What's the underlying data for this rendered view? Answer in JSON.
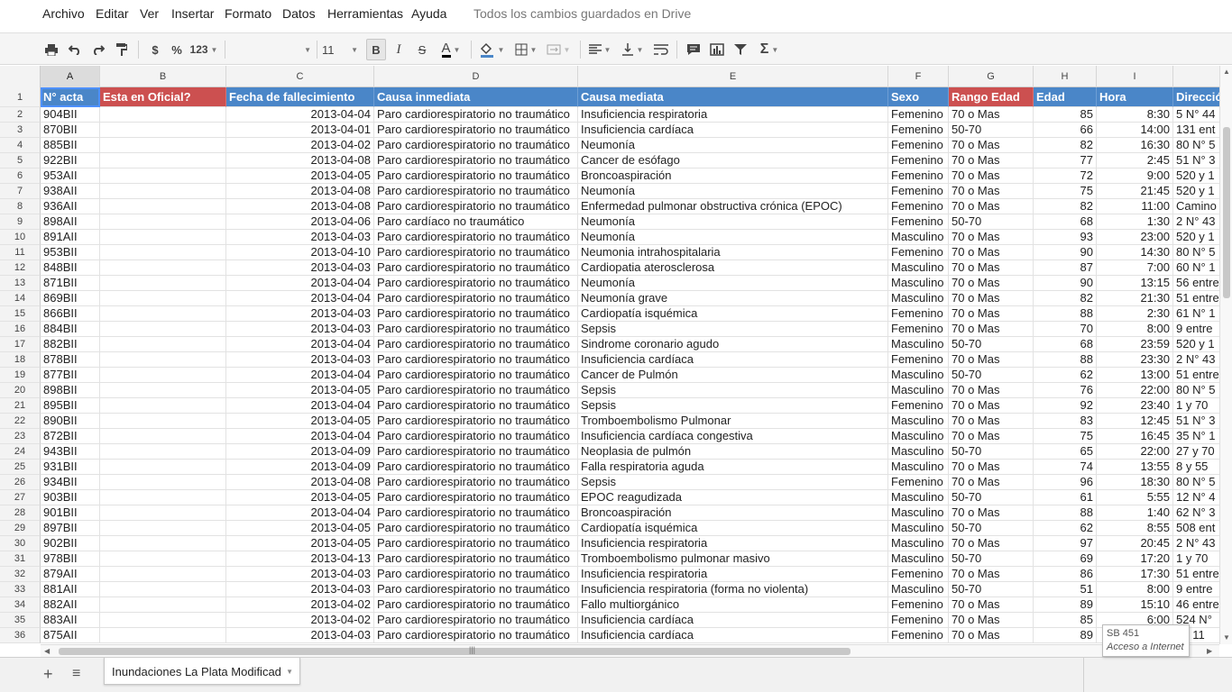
{
  "menu": {
    "items": [
      "Archivo",
      "Editar",
      "Ver",
      "Insertar",
      "Formato",
      "Datos",
      "Herramientas",
      "Ayuda"
    ],
    "save_status": "Todos los cambios guardados en Drive"
  },
  "toolbar": {
    "currency": "$",
    "percent": "%",
    "number_format": "123",
    "font_size": "11",
    "bold": "B",
    "italic": "I",
    "strike": "S",
    "text_color": "A",
    "sum": "Σ"
  },
  "columns": [
    "A",
    "B",
    "C",
    "D",
    "E",
    "F",
    "G",
    "H",
    "I",
    ""
  ],
  "headers": [
    "N° acta",
    "Esta en Oficial?",
    "Fecha de fallecimiento",
    "Causa inmediata",
    "Causa mediata",
    "Sexo",
    "Rango Edad",
    "Edad",
    "Hora",
    "Direcció"
  ],
  "row_numbers": [
    "1",
    "2",
    "3",
    "4",
    "5",
    "6",
    "7",
    "8",
    "9",
    "10",
    "11",
    "12",
    "13",
    "14",
    "15",
    "16",
    "17",
    "18",
    "19",
    "20",
    "21",
    "22",
    "23",
    "24",
    "25",
    "26",
    "27",
    "28",
    "29",
    "30",
    "31",
    "32",
    "33",
    "34",
    "35",
    "36"
  ],
  "rows": [
    [
      "904BII",
      "",
      "2013-04-04",
      "Paro cardiorespiratorio no traumático",
      "Insuficiencia respiratoria",
      "Femenino",
      "70 o Mas",
      "85",
      "8:30",
      "5 N° 44"
    ],
    [
      "870BII",
      "",
      "2013-04-01",
      "Paro cardiorespiratorio no traumático",
      "Insuficiencia cardíaca",
      "Femenino",
      "50-70",
      "66",
      "14:00",
      "131 ent"
    ],
    [
      "885BII",
      "",
      "2013-04-02",
      "Paro cardiorespiratorio no traumático",
      "Neumonía",
      "Femenino",
      "70 o Mas",
      "82",
      "16:30",
      "80 N° 5"
    ],
    [
      "922BII",
      "",
      "2013-04-08",
      "Paro cardiorespiratorio no traumático",
      "Cancer de esófago",
      "Femenino",
      "70 o Mas",
      "77",
      "2:45",
      "51 N° 3"
    ],
    [
      "953AII",
      "",
      "2013-04-05",
      "Paro cardiorespiratorio no traumático",
      "Broncoaspiración",
      "Femenino",
      "70 o Mas",
      "72",
      "9:00",
      "520 y 1"
    ],
    [
      "938AII",
      "",
      "2013-04-08",
      "Paro cardiorespiratorio no traumático",
      "Neumonía",
      "Femenino",
      "70 o Mas",
      "75",
      "21:45",
      "520 y 1"
    ],
    [
      "936AII",
      "",
      "2013-04-08",
      "Paro cardiorespiratorio no traumático",
      "Enfermedad pulmonar obstructiva crónica (EPOC)",
      "Femenino",
      "70 o Mas",
      "82",
      "11:00",
      "Camino"
    ],
    [
      "898AII",
      "",
      "2013-04-06",
      "Paro cardíaco no traumático",
      "Neumonía",
      "Femenino",
      "50-70",
      "68",
      "1:30",
      "2 N° 43"
    ],
    [
      "891AII",
      "",
      "2013-04-03",
      "Paro cardiorespiratorio no traumático",
      "Neumonía",
      "Masculino",
      "70 o Mas",
      "93",
      "23:00",
      "520 y 1"
    ],
    [
      "953BII",
      "",
      "2013-04-10",
      "Paro cardiorespiratorio no traumático",
      "Neumonia intrahospitalaria",
      "Femenino",
      "70 o Mas",
      "90",
      "14:30",
      "80 N° 5"
    ],
    [
      "848BII",
      "",
      "2013-04-03",
      "Paro cardiorespiratorio no traumático",
      "Cardiopatia aterosclerosa",
      "Masculino",
      "70 o Mas",
      "87",
      "7:00",
      "60 N° 1"
    ],
    [
      "871BII",
      "",
      "2013-04-04",
      "Paro cardiorespiratorio no traumático",
      "Neumonía",
      "Masculino",
      "70 o Mas",
      "90",
      "13:15",
      "56 entre"
    ],
    [
      "869BII",
      "",
      "2013-04-04",
      "Paro cardiorespiratorio no traumático",
      "Neumonía grave",
      "Masculino",
      "70 o Mas",
      "82",
      "21:30",
      "51 entre"
    ],
    [
      "866BII",
      "",
      "2013-04-03",
      "Paro cardiorespiratorio no traumático",
      "Cardiopatía isquémica",
      "Femenino",
      "70 o Mas",
      "88",
      "2:30",
      "61 N° 1"
    ],
    [
      "884BII",
      "",
      "2013-04-03",
      "Paro cardiorespiratorio no traumático",
      "Sepsis",
      "Femenino",
      "70 o Mas",
      "70",
      "8:00",
      "9 entre"
    ],
    [
      "882BII",
      "",
      "2013-04-04",
      "Paro cardiorespiratorio no traumático",
      "Sindrome coronario agudo",
      "Masculino",
      "50-70",
      "68",
      "23:59",
      "520 y 1"
    ],
    [
      "878BII",
      "",
      "2013-04-03",
      "Paro cardiorespiratorio no traumático",
      "Insuficiencia cardíaca",
      "Femenino",
      "70 o Mas",
      "88",
      "23:30",
      "2 N° 43"
    ],
    [
      "877BII",
      "",
      "2013-04-04",
      "Paro cardiorespiratorio no traumático",
      "Cancer de Pulmón",
      "Masculino",
      "50-70",
      "62",
      "13:00",
      "51 entre"
    ],
    [
      "898BII",
      "",
      "2013-04-05",
      "Paro cardiorespiratorio no traumático",
      "Sepsis",
      "Masculino",
      "70 o Mas",
      "76",
      "22:00",
      "80 N° 5"
    ],
    [
      "895BII",
      "",
      "2013-04-04",
      "Paro cardiorespiratorio no traumático",
      "Sepsis",
      "Femenino",
      "70 o Mas",
      "92",
      "23:40",
      "1 y 70"
    ],
    [
      "890BII",
      "",
      "2013-04-05",
      "Paro cardiorespiratorio no traumático",
      "Tromboembolismo Pulmonar",
      "Masculino",
      "70 o Mas",
      "83",
      "12:45",
      "51 N° 3"
    ],
    [
      "872BII",
      "",
      "2013-04-04",
      "Paro cardiorespiratorio no traumático",
      "Insuficiencia cardíaca congestiva",
      "Masculino",
      "70 o Mas",
      "75",
      "16:45",
      "35 N° 1"
    ],
    [
      "943BII",
      "",
      "2013-04-09",
      "Paro cardiorespiratorio no traumático",
      "Neoplasia de pulmón",
      "Masculino",
      "50-70",
      "65",
      "22:00",
      "27 y 70"
    ],
    [
      "931BII",
      "",
      "2013-04-09",
      "Paro cardiorespiratorio no traumático",
      "Falla respiratoria aguda",
      "Masculino",
      "70 o Mas",
      "74",
      "13:55",
      "8 y 55"
    ],
    [
      "934BII",
      "",
      "2013-04-08",
      "Paro cardiorespiratorio no traumático",
      "Sepsis",
      "Femenino",
      "70 o Mas",
      "96",
      "18:30",
      "80 N° 5"
    ],
    [
      "903BII",
      "",
      "2013-04-05",
      "Paro cardiorespiratorio no traumático",
      "EPOC reagudizada",
      "Masculino",
      "50-70",
      "61",
      "5:55",
      "12 N° 4"
    ],
    [
      "901BII",
      "",
      "2013-04-04",
      "Paro cardiorespiratorio no traumático",
      "Broncoaspiración",
      "Masculino",
      "70 o Mas",
      "88",
      "1:40",
      "62 N° 3"
    ],
    [
      "897BII",
      "",
      "2013-04-05",
      "Paro cardiorespiratorio no traumático",
      "Cardiopatía isquémica",
      "Masculino",
      "50-70",
      "62",
      "8:55",
      "508 ent"
    ],
    [
      "902BII",
      "",
      "2013-04-05",
      "Paro cardiorespiratorio no traumático",
      "Insuficiencia respiratoria",
      "Masculino",
      "70 o Mas",
      "97",
      "20:45",
      "2 N° 43"
    ],
    [
      "978BII",
      "",
      "2013-04-13",
      "Paro cardiorespiratorio no traumático",
      "Tromboembolismo pulmonar masivo",
      "Masculino",
      "50-70",
      "69",
      "17:20",
      "1 y 70"
    ],
    [
      "879AII",
      "",
      "2013-04-03",
      "Paro cardiorespiratorio no traumático",
      "Insuficiencia respiratoria",
      "Femenino",
      "70 o Mas",
      "86",
      "17:30",
      "51 entre"
    ],
    [
      "881AII",
      "",
      "2013-04-03",
      "Paro cardiorespiratorio no traumático",
      "Insuficiencia respiratoria (forma no violenta)",
      "Masculino",
      "50-70",
      "51",
      "8:00",
      "9 entre"
    ],
    [
      "882AII",
      "",
      "2013-04-02",
      "Paro cardiorespiratorio no traumático",
      "Fallo multiorgánico",
      "Femenino",
      "70 o Mas",
      "89",
      "15:10",
      "46 entre"
    ],
    [
      "883AII",
      "",
      "2013-04-02",
      "Paro cardiorespiratorio no traumático",
      "Insuficiencia cardíaca",
      "Femenino",
      "70 o Mas",
      "85",
      "6:00",
      "524 N°"
    ],
    [
      "875AII",
      "",
      "2013-04-03",
      "Paro cardiorespiratorio no traumático",
      "Insuficiencia cardíaca",
      "Femenino",
      "70 o Mas",
      "89",
      "",
      "N° 11"
    ]
  ],
  "sheet_tab": "Inundaciones La Plata Modificad",
  "tooltip": {
    "line1": "SB 451",
    "line2": "Acceso a Internet"
  },
  "colors": {
    "header_blue": "#4a86c8",
    "header_red": "#cc5050",
    "selection": "#4d90fe"
  }
}
